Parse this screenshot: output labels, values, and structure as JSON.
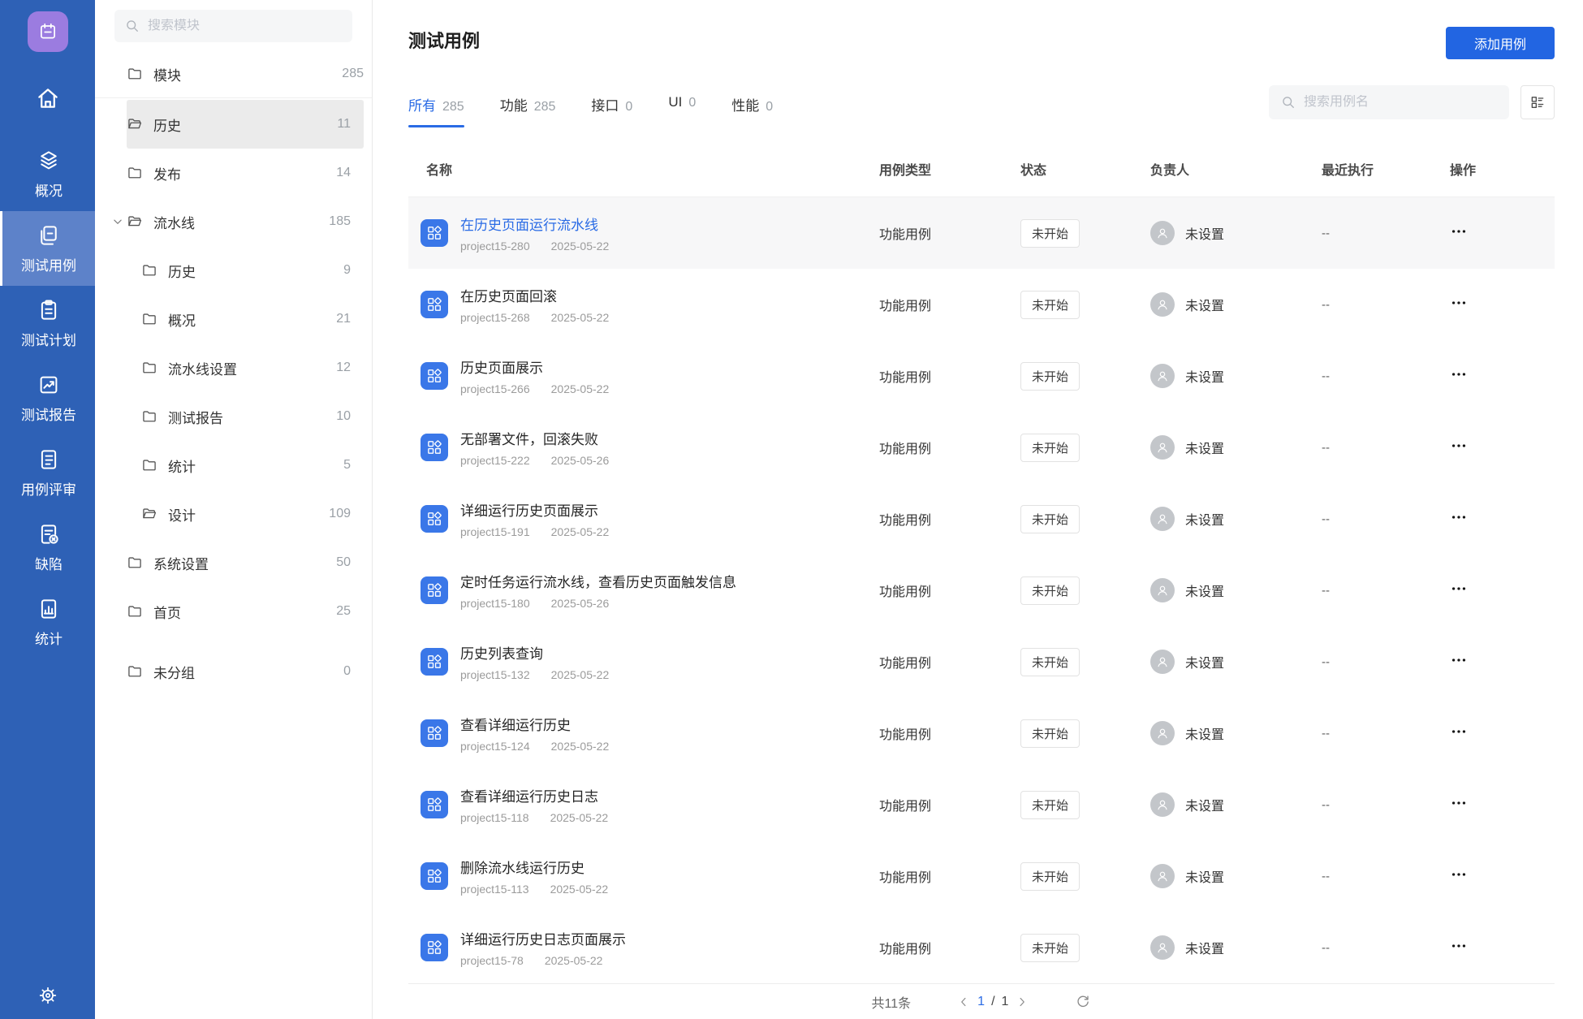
{
  "colors": {
    "sidebar": "#2e61b6",
    "sidebar_active": "#5d82c9",
    "logo": "#9b7ce0",
    "primary": "#2265e2",
    "link": "#2a6be5"
  },
  "sidebar": {
    "logo_icon": "calendar-icon",
    "home_icon": "home-icon",
    "settings_icon": "gear-icon",
    "items": [
      {
        "label": "概况",
        "icon": "layers-icon",
        "active": false
      },
      {
        "label": "测试用例",
        "icon": "cases-icon",
        "active": true
      },
      {
        "label": "测试计划",
        "icon": "clipboard-icon",
        "active": false
      },
      {
        "label": "测试报告",
        "icon": "report-icon",
        "active": false
      },
      {
        "label": "用例评审",
        "icon": "review-icon",
        "active": false
      },
      {
        "label": "缺陷",
        "icon": "defect-icon",
        "active": false
      },
      {
        "label": "统计",
        "icon": "stats-icon",
        "active": false
      }
    ]
  },
  "tree": {
    "search_placeholder": "搜索模块",
    "root": {
      "label": "模块",
      "count": "285"
    },
    "items": [
      {
        "label": "历史",
        "count": "11",
        "level": 0,
        "folder": "open",
        "selected": true,
        "expanded": false,
        "gap_top": false
      },
      {
        "label": "发布",
        "count": "14",
        "level": 0,
        "folder": "closed",
        "selected": false,
        "expanded": false,
        "gap_top": false
      },
      {
        "label": "流水线",
        "count": "185",
        "level": 0,
        "folder": "open",
        "selected": false,
        "expanded": true,
        "gap_top": false
      },
      {
        "label": "历史",
        "count": "9",
        "level": 1,
        "folder": "closed",
        "selected": false,
        "expanded": false,
        "gap_top": false
      },
      {
        "label": "概况",
        "count": "21",
        "level": 1,
        "folder": "closed",
        "selected": false,
        "expanded": false,
        "gap_top": false
      },
      {
        "label": "流水线设置",
        "count": "12",
        "level": 1,
        "folder": "closed",
        "selected": false,
        "expanded": false,
        "gap_top": false
      },
      {
        "label": "测试报告",
        "count": "10",
        "level": 1,
        "folder": "closed",
        "selected": false,
        "expanded": false,
        "gap_top": false
      },
      {
        "label": "统计",
        "count": "5",
        "level": 1,
        "folder": "closed",
        "selected": false,
        "expanded": false,
        "gap_top": false
      },
      {
        "label": "设计",
        "count": "109",
        "level": 1,
        "folder": "open",
        "selected": false,
        "expanded": false,
        "gap_top": false
      },
      {
        "label": "系统设置",
        "count": "50",
        "level": 0,
        "folder": "closed",
        "selected": false,
        "expanded": false,
        "gap_top": false
      },
      {
        "label": "首页",
        "count": "25",
        "level": 0,
        "folder": "closed",
        "selected": false,
        "expanded": false,
        "gap_top": false
      },
      {
        "label": "未分组",
        "count": "0",
        "level": 0,
        "folder": "closed",
        "selected": false,
        "expanded": false,
        "gap_top": true
      }
    ]
  },
  "main": {
    "title": "测试用例",
    "add_button_label": "添加用例",
    "search_placeholder": "搜索用例名",
    "tabs": [
      {
        "label": "所有",
        "count": "285",
        "active": true
      },
      {
        "label": "功能",
        "count": "285",
        "active": false
      },
      {
        "label": "接口",
        "count": "0",
        "active": false
      },
      {
        "label": "UI",
        "count": "0",
        "active": false
      },
      {
        "label": "性能",
        "count": "0",
        "active": false
      }
    ],
    "table": {
      "columns": [
        "名称",
        "用例类型",
        "状态",
        "负责人",
        "最近执行",
        "操作"
      ],
      "rows": [
        {
          "title": "在历史页面运行流水线",
          "id": "project15-280",
          "date": "2025-05-22",
          "type": "功能用例",
          "status": "未开始",
          "owner": "未设置",
          "recent": "--",
          "highlighted": true
        },
        {
          "title": "在历史页面回滚",
          "id": "project15-268",
          "date": "2025-05-22",
          "type": "功能用例",
          "status": "未开始",
          "owner": "未设置",
          "recent": "--",
          "highlighted": false
        },
        {
          "title": "历史页面展示",
          "id": "project15-266",
          "date": "2025-05-22",
          "type": "功能用例",
          "status": "未开始",
          "owner": "未设置",
          "recent": "--",
          "highlighted": false
        },
        {
          "title": "无部署文件，回滚失败",
          "id": "project15-222",
          "date": "2025-05-26",
          "type": "功能用例",
          "status": "未开始",
          "owner": "未设置",
          "recent": "--",
          "highlighted": false
        },
        {
          "title": "详细运行历史页面展示",
          "id": "project15-191",
          "date": "2025-05-22",
          "type": "功能用例",
          "status": "未开始",
          "owner": "未设置",
          "recent": "--",
          "highlighted": false
        },
        {
          "title": "定时任务运行流水线，查看历史页面触发信息",
          "id": "project15-180",
          "date": "2025-05-26",
          "type": "功能用例",
          "status": "未开始",
          "owner": "未设置",
          "recent": "--",
          "highlighted": false
        },
        {
          "title": "历史列表查询",
          "id": "project15-132",
          "date": "2025-05-22",
          "type": "功能用例",
          "status": "未开始",
          "owner": "未设置",
          "recent": "--",
          "highlighted": false
        },
        {
          "title": "查看详细运行历史",
          "id": "project15-124",
          "date": "2025-05-22",
          "type": "功能用例",
          "status": "未开始",
          "owner": "未设置",
          "recent": "--",
          "highlighted": false
        },
        {
          "title": "查看详细运行历史日志",
          "id": "project15-118",
          "date": "2025-05-22",
          "type": "功能用例",
          "status": "未开始",
          "owner": "未设置",
          "recent": "--",
          "highlighted": false
        },
        {
          "title": "删除流水线运行历史",
          "id": "project15-113",
          "date": "2025-05-22",
          "type": "功能用例",
          "status": "未开始",
          "owner": "未设置",
          "recent": "--",
          "highlighted": false
        },
        {
          "title": "详细运行历史日志页面展示",
          "id": "project15-78",
          "date": "2025-05-22",
          "type": "功能用例",
          "status": "未开始",
          "owner": "未设置",
          "recent": "--",
          "highlighted": false
        }
      ]
    },
    "pagination": {
      "total_label": "共11条",
      "current_page": "1",
      "separator": "/",
      "total_pages": "1"
    }
  }
}
